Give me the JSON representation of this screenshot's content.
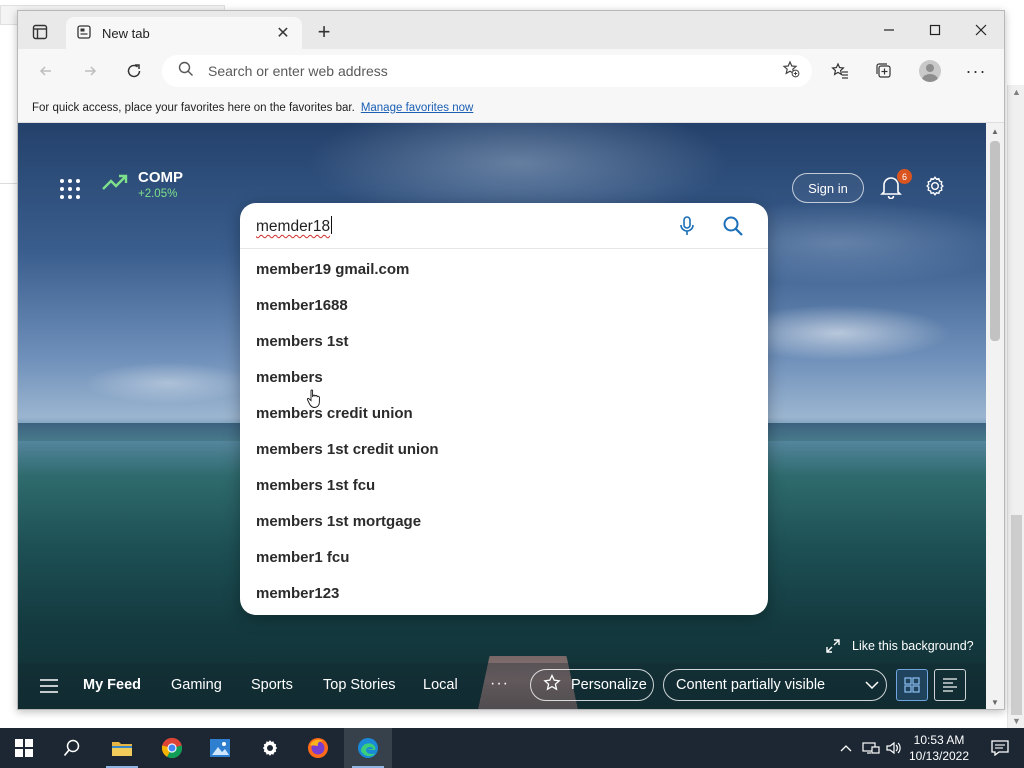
{
  "browser": {
    "tab": {
      "label": "New tab"
    },
    "address_bar": {
      "placeholder": "Search or enter web address"
    },
    "favorites_bar": {
      "message": "For quick access, place your favorites here on the favorites bar.",
      "link_label": "Manage favorites now"
    }
  },
  "page": {
    "ticker": {
      "symbol": "COMP",
      "change": "+2.05%"
    },
    "sign_in_label": "Sign in",
    "notification_count": "6",
    "search": {
      "typed_value_misspelled": "memder18",
      "suggestions": [
        "member19 gmail.com",
        "member1688",
        "members 1st",
        "members",
        "members credit union",
        "members 1st credit union",
        "members 1st fcu",
        "members 1st mortgage",
        "member1 fcu",
        "member123"
      ]
    },
    "like_background_label": "Like this background?",
    "feed": {
      "tabs": [
        "My Feed",
        "Gaming",
        "Sports",
        "Top Stories",
        "Local"
      ],
      "more_label": "···",
      "personalize_label": "Personalize",
      "visibility_label": "Content partially visible"
    }
  },
  "taskbar": {
    "time": "10:53 AM",
    "date": "10/13/2022",
    "apps": [
      "start-icon",
      "search-icon",
      "file-explorer-icon",
      "chrome-icon",
      "photos-icon",
      "settings-icon",
      "firefox-icon",
      "edge-icon"
    ]
  },
  "colors": {
    "accent_blue": "#1a5fb4",
    "ticker_green": "#7ee08a",
    "badge_orange": "#d9541e",
    "taskbar": "#1c2733"
  }
}
